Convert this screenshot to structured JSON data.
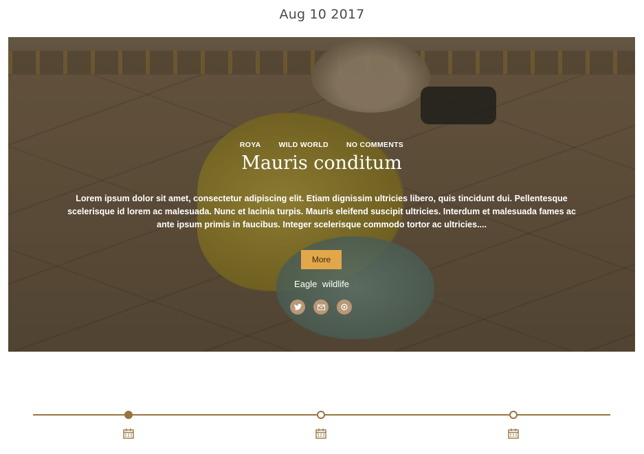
{
  "post": {
    "date": "Aug 10 2017",
    "meta": {
      "author": "ROYA",
      "category": "WILD WORLD",
      "comments": "NO COMMENTS"
    },
    "title": "Mauris conditum",
    "excerpt": "Lorem ipsum dolor sit amet, consectetur adipiscing elit. Etiam dignissim ultricies libero, quis tincidunt dui. Pellentesque scelerisque id lorem ac malesuada. Nunc et lacinia turpis. Mauris eleifend suscipit ultricies. Interdum et malesuada fames ac ante ipsum primis in faucibus. Integer scelerisque commodo tortor ac ultricies....",
    "more_label": "More",
    "tags": [
      "Eagle",
      "wildlife"
    ],
    "share_icons": [
      "twitter-icon",
      "email-icon",
      "pinterest-icon"
    ]
  },
  "timeline": {
    "nodes": [
      "active",
      "inactive",
      "inactive"
    ],
    "node_icon": "calendar-icon"
  },
  "colors": {
    "accent": "#98743f",
    "button": "#e3a74b",
    "share_circle": "#b89877"
  }
}
